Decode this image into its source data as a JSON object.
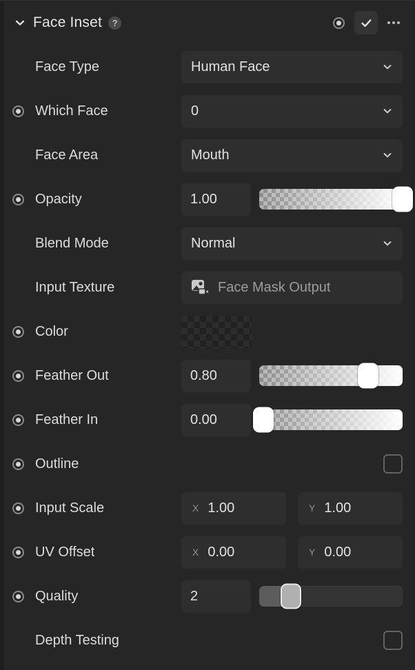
{
  "header": {
    "title": "Face Inset",
    "help_icon": "help-circle-icon",
    "collapse_icon": "chevron-down-icon",
    "record_icon": "record-dot-icon",
    "enabled_icon": "check-icon",
    "more_icon": "more-options-icon"
  },
  "rows": [
    {
      "label": "Face Type",
      "type": "select",
      "value": "Human Face",
      "record": false
    },
    {
      "label": "Which Face",
      "type": "select",
      "value": "0",
      "record": true
    },
    {
      "label": "Face Area",
      "type": "select",
      "value": "Mouth",
      "record": false
    },
    {
      "label": "Opacity",
      "type": "slider",
      "value": "1.00",
      "percent": 100,
      "record": true
    },
    {
      "label": "Blend Mode",
      "type": "select",
      "value": "Normal",
      "record": false
    },
    {
      "label": "Input Texture",
      "type": "texture",
      "value": "Face Mask Output",
      "icon": "image-video-icon",
      "record": false
    },
    {
      "label": "Color",
      "type": "color",
      "value": "#FFFFFF00",
      "record": true
    },
    {
      "label": "Feather Out",
      "type": "slider",
      "value": "0.80",
      "percent": 80,
      "record": true
    },
    {
      "label": "Feather In",
      "type": "slider",
      "value": "0.00",
      "percent": 0,
      "record": true
    },
    {
      "label": "Outline",
      "type": "checkbox",
      "checked": false,
      "record": true
    },
    {
      "label": "Input Scale",
      "type": "xy",
      "x": "1.00",
      "y": "1.00",
      "x_axis": "X",
      "y_axis": "Y",
      "record": true
    },
    {
      "label": "UV Offset",
      "type": "xy",
      "x": "0.00",
      "y": "0.00",
      "x_axis": "X",
      "y_axis": "Y",
      "record": true
    },
    {
      "label": "Quality",
      "type": "slider-plain",
      "value": "2",
      "percent": 22,
      "record": true
    },
    {
      "label": "Depth Testing",
      "type": "checkbox",
      "checked": false,
      "record": false
    }
  ],
  "colors": {
    "panel_bg": "#262626",
    "field_bg": "#2e2e2e",
    "text": "#dcdcdc",
    "muted_text": "#9d9d9d",
    "accent_white": "#ffffff"
  }
}
